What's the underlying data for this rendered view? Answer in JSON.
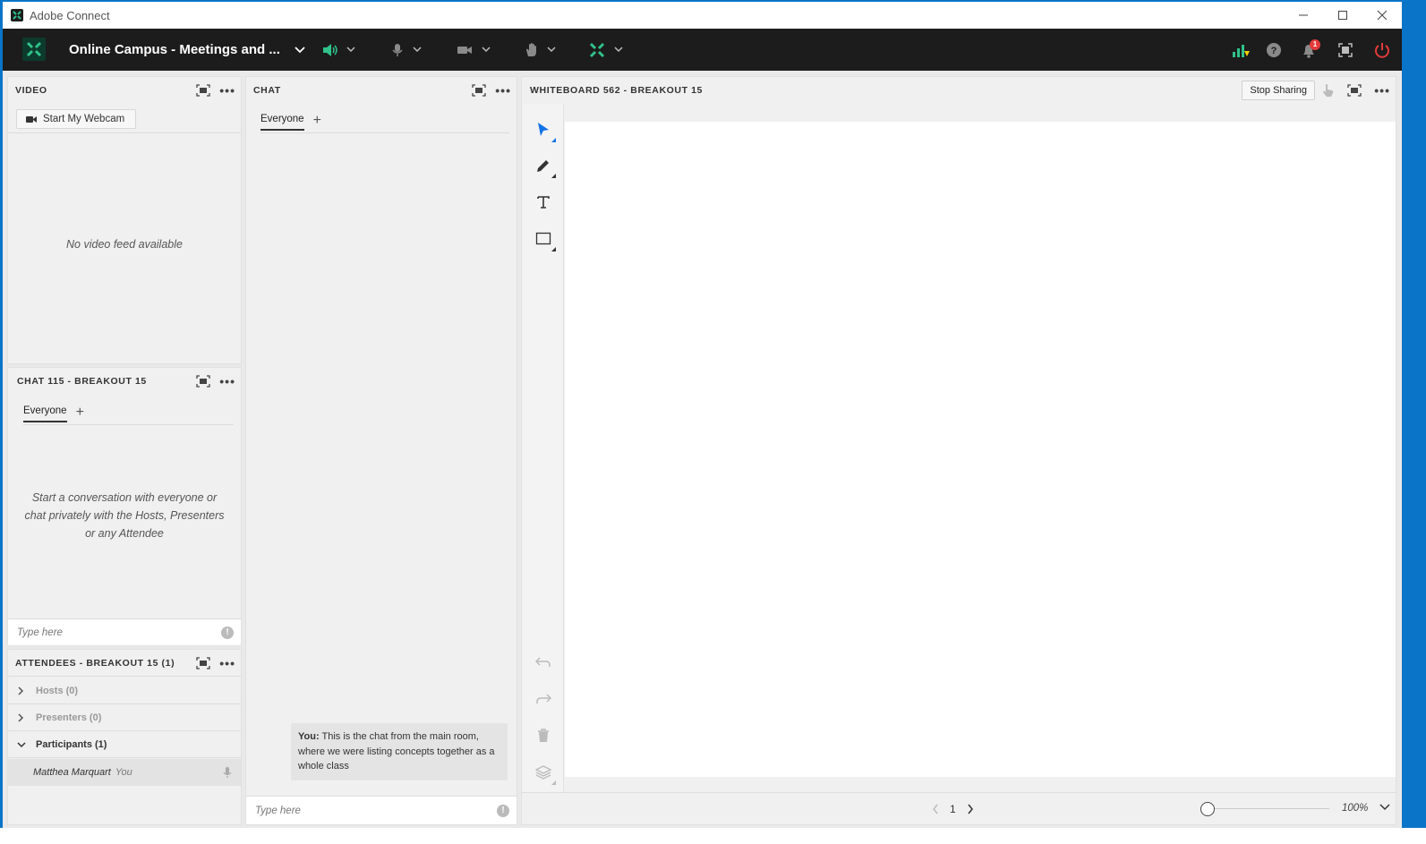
{
  "window": {
    "title": "Adobe Connect"
  },
  "topbar": {
    "room_title": "Online Campus - Meetings and ...",
    "notification_count": "1",
    "colors": {
      "background": "#1c1c1c",
      "accent": "#2fc28a",
      "alert": "#e33a3a"
    }
  },
  "video_pod": {
    "title": "VIDEO",
    "webcam_button": "Start My Webcam",
    "empty_text": "No video feed available"
  },
  "breakout_chat_pod": {
    "title": "CHAT 115  - BREAKOUT 15",
    "tab": "Everyone",
    "empty_text": "Start a conversation with everyone or chat privately with the Hosts, Presenters or any Attendee",
    "input_placeholder": "Type here"
  },
  "attendees_pod": {
    "title": "ATTENDEES - BREAKOUT 15 (1)",
    "groups": [
      {
        "label": "Hosts (0)"
      },
      {
        "label": "Presenters (0)"
      },
      {
        "label": "Participants (1)"
      }
    ],
    "person": {
      "name": "Matthea Marquart",
      "tag": "You"
    }
  },
  "main_chat_pod": {
    "title": "CHAT",
    "tab": "Everyone",
    "message": {
      "sender": "You:",
      "text": "This is the chat from the main room, where we were listing concepts together as a whole class"
    },
    "input_placeholder": "Type here"
  },
  "whiteboard_pod": {
    "title": "WHITEBOARD 562  - BREAKOUT 15",
    "stop_sharing": "Stop Sharing",
    "page": "1",
    "zoom": "100%",
    "tool_icons": [
      "select-icon",
      "pencil-icon",
      "text-icon",
      "shape-icon"
    ],
    "action_icons": [
      "undo-icon",
      "redo-icon",
      "trash-icon",
      "layers-icon"
    ],
    "colors": {
      "select_tool": "#1473e6"
    }
  }
}
